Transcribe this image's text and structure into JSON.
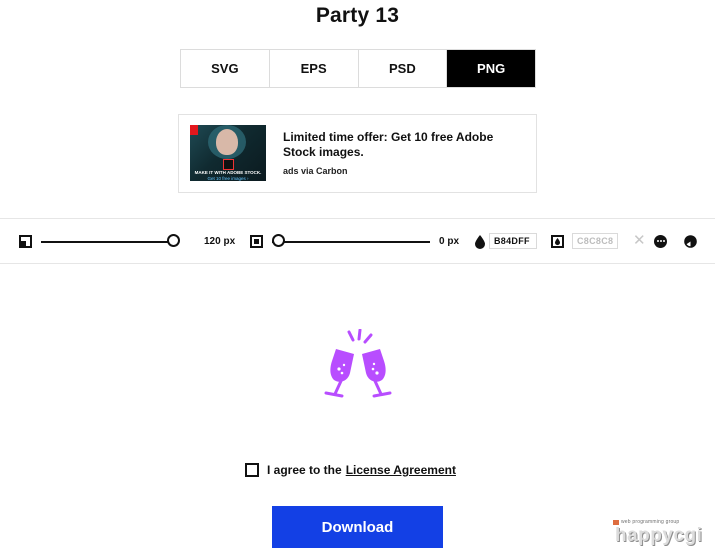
{
  "page": {
    "title": "Party 13"
  },
  "formats": [
    {
      "label": "SVG",
      "active": false
    },
    {
      "label": "EPS",
      "active": false
    },
    {
      "label": "PSD",
      "active": false
    },
    {
      "label": "PNG",
      "active": true
    }
  ],
  "ad": {
    "headline": "Limited time offer: Get 10 free Adobe Stock images.",
    "via": "ads via Carbon",
    "image_text": "MAKE IT WITH ADOBE STOCK.",
    "image_cta": "Get 10 free images ›"
  },
  "toolbar": {
    "size_value": "120 px",
    "size_level": 1.0,
    "padding_value": "0 px",
    "padding_level": 0.0,
    "icon_color": "B84DFF",
    "background_color": "C8C8C8"
  },
  "preview": {
    "icon": "champagne-toast-icon",
    "color": "#B84DFF"
  },
  "license": {
    "prefix": "I agree to the",
    "link": "License Agreement"
  },
  "download": {
    "label": "Download"
  },
  "watermark": {
    "small": "web programming group",
    "big": "happycgi"
  }
}
